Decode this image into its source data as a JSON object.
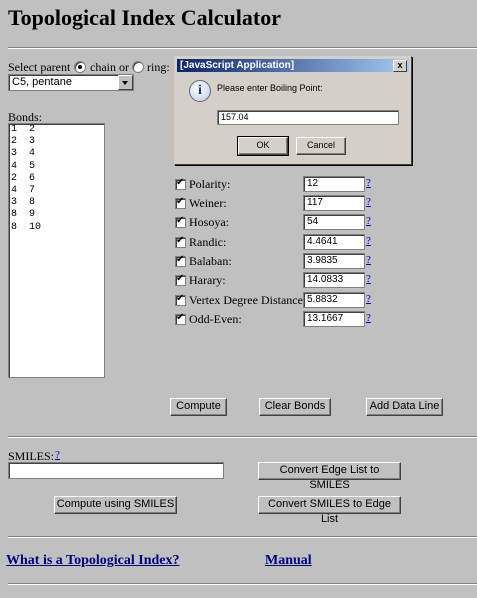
{
  "page": {
    "title": "Topological Index Calculator",
    "select_parent_label": "Select parent",
    "chain_label": "chain or",
    "ring_label": "ring:",
    "parent_selected": "C5, pentane",
    "bonds_label": "Bonds:",
    "bonds": [
      "1  2",
      "2  3",
      "3  4",
      "4  5",
      "2  6",
      "4  7",
      "3  8",
      "8  9",
      "8  10"
    ]
  },
  "indices": [
    {
      "label": "Polarity:",
      "value": "12"
    },
    {
      "label": "Weiner:",
      "value": "117"
    },
    {
      "label": "Hosoya:",
      "value": "54"
    },
    {
      "label": "Randic:",
      "value": "4.4641"
    },
    {
      "label": "Balaban:",
      "value": "3.9835"
    },
    {
      "label": "Harary:",
      "value": "14.0833"
    },
    {
      "label": "Vertex Degree Distance:",
      "value": "5.8832"
    },
    {
      "label": "Odd-Even:",
      "value": "13.1667"
    }
  ],
  "help_glyph": "?",
  "buttons": {
    "compute": "Compute",
    "clear_bonds": "Clear Bonds",
    "add_data_line": "Add Data Line",
    "convert_edge_to_smiles": "Convert Edge List to SMILES",
    "compute_smiles": "Compute using SMILES",
    "convert_smiles_to_edge": "Convert SMILES to Edge List"
  },
  "smiles": {
    "label": "SMILES:",
    "value": ""
  },
  "links": {
    "what_is": "What is a Topological Index?",
    "manual": "Manual"
  },
  "dialog": {
    "title": "[JavaScript Application]",
    "close": "x",
    "message": "Please enter Boiling Point:",
    "input_value": "157.04",
    "ok": "OK",
    "cancel": "Cancel"
  }
}
